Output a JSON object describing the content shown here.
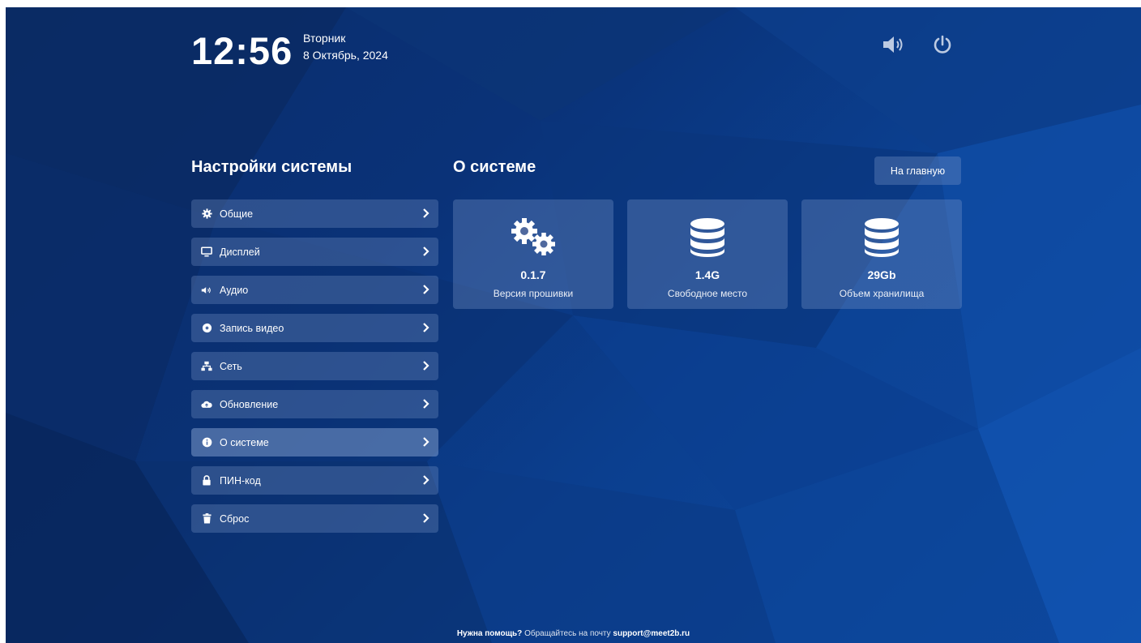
{
  "header": {
    "time": "12:56",
    "weekday": "Вторник",
    "date": "8 Октябрь, 2024",
    "icons": [
      "volume-icon",
      "power-icon"
    ]
  },
  "sidebar": {
    "title": "Настройки системы",
    "items": [
      {
        "label": "Общие",
        "icon": "gear-icon"
      },
      {
        "label": "Дисплей",
        "icon": "monitor-icon"
      },
      {
        "label": "Аудио",
        "icon": "volume-icon"
      },
      {
        "label": "Запись видео",
        "icon": "record-icon"
      },
      {
        "label": "Сеть",
        "icon": "network-icon"
      },
      {
        "label": "Обновление",
        "icon": "cloud-upload-icon"
      },
      {
        "label": "О системе",
        "icon": "info-icon",
        "active": true
      },
      {
        "label": "ПИН-код",
        "icon": "lock-icon"
      },
      {
        "label": "Сброс",
        "icon": "trash-icon"
      }
    ]
  },
  "main": {
    "title": "О системе",
    "home_button": "На главную",
    "cards": [
      {
        "value": "0.1.7",
        "label": "Версия прошивки",
        "icon": "gears-icon"
      },
      {
        "value": "1.4G",
        "label": "Свободное место",
        "icon": "database-icon"
      },
      {
        "value": "29Gb",
        "label": "Объем хранилища",
        "icon": "database-icon"
      }
    ]
  },
  "footer": {
    "help": "Нужна помощь?",
    "text": "Обращайтесь на почту",
    "email": "support@meet2b.ru"
  },
  "colors": {
    "background": "#0b3580",
    "panel": "rgba(120,150,200,0.32)"
  }
}
